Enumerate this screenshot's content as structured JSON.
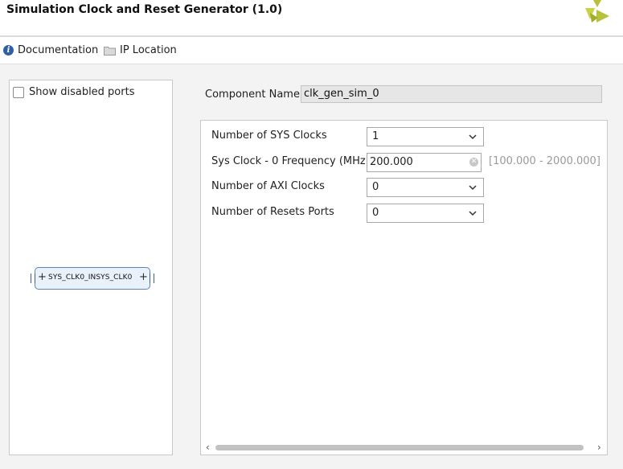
{
  "header": {
    "title": "Simulation Clock and Reset Generator (1.0)"
  },
  "toolbar": {
    "documentation": "Documentation",
    "ip_location": "IP Location"
  },
  "left_panel": {
    "show_disabled_ports": "Show disabled ports",
    "block": {
      "port_in": "SYS_CLK0_IN",
      "port_out": "SYS_CLK0"
    }
  },
  "component": {
    "label": "Component Name",
    "value": "clk_gen_sim_0"
  },
  "config": {
    "sys_clocks": {
      "label": "Number of SYS Clocks",
      "value": "1"
    },
    "sys_clock_freq": {
      "label": "Sys Clock - 0 Frequency (MHz)",
      "value": "200.000",
      "range": "[100.000 - 2000.000]"
    },
    "axi_clocks": {
      "label": "Number of AXI Clocks",
      "value": "0"
    },
    "resets_ports": {
      "label": "Number of Resets Ports",
      "value": "0"
    }
  },
  "colors": {
    "logo": "#b7c23a",
    "accent": "#2f5fa7",
    "block_fill": "#e9f1fb"
  },
  "icons": [
    "info-icon",
    "folder-icon",
    "chevron-down-icon",
    "clear-icon",
    "logo-icon"
  ]
}
